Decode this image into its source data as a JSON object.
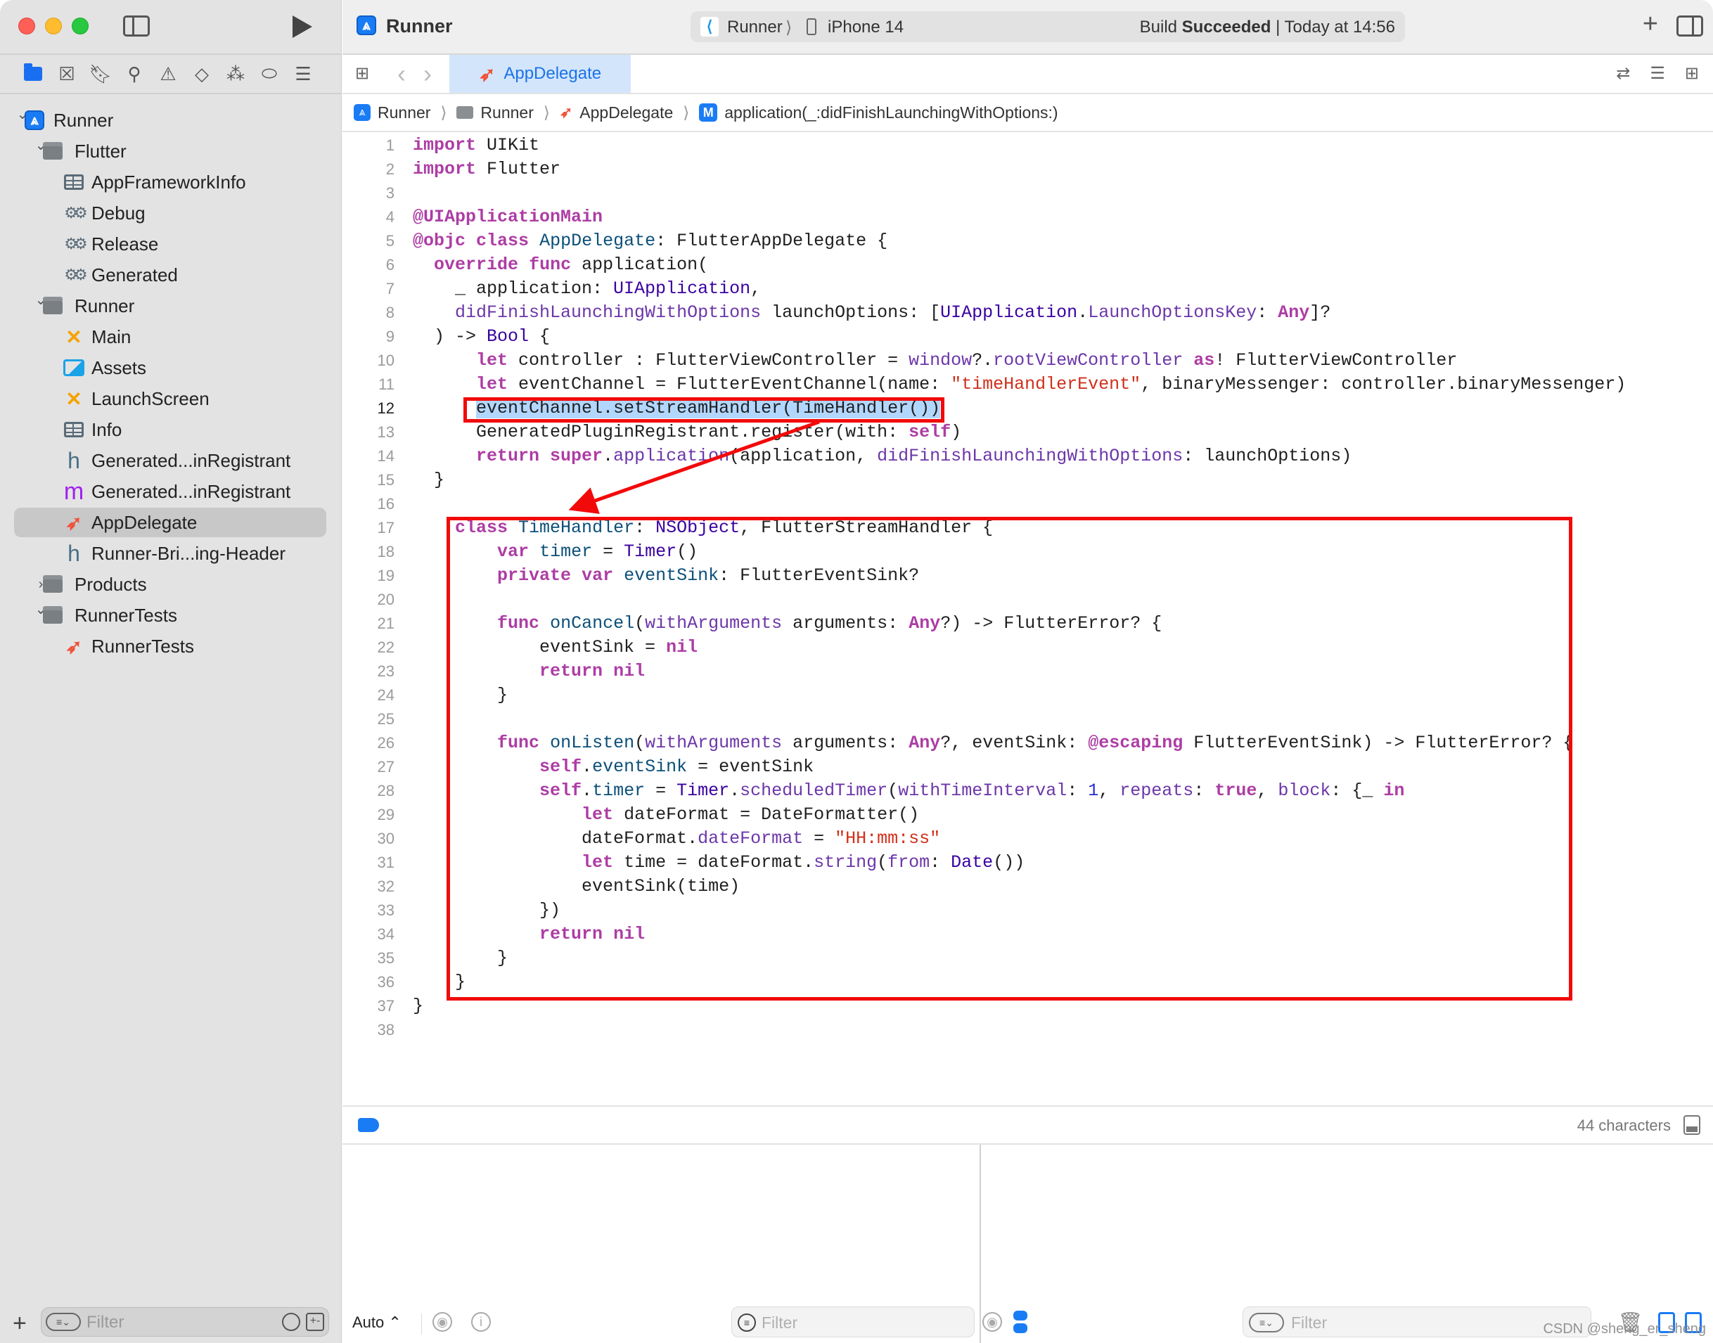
{
  "window": {
    "project_title": "Runner",
    "scheme": "Runner",
    "device": "iPhone 14",
    "build_status_prefix": "Build",
    "build_status": "Succeeded",
    "build_time": "| Today at 14:56"
  },
  "navigator": {
    "icons": [
      "project-navigator-icon",
      "source-control-icon",
      "bookmark-icon",
      "find-icon",
      "issue-icon",
      "test-icon",
      "debug-icon",
      "breakpoint-icon",
      "report-icon"
    ],
    "tree": [
      {
        "label": "Runner",
        "icon": "app-project-icon",
        "level": 0,
        "expanded": true
      },
      {
        "label": "Flutter",
        "icon": "folder-icon",
        "level": 1,
        "expanded": true
      },
      {
        "label": "AppFrameworkInfo",
        "icon": "plist-icon",
        "level": 2
      },
      {
        "label": "Debug",
        "icon": "xcconfig-icon",
        "level": 2
      },
      {
        "label": "Release",
        "icon": "xcconfig-icon",
        "level": 2
      },
      {
        "label": "Generated",
        "icon": "xcconfig-icon",
        "level": 2
      },
      {
        "label": "Runner",
        "icon": "folder-icon",
        "level": 1,
        "expanded": true
      },
      {
        "label": "Main",
        "icon": "storyboard-icon",
        "level": 2
      },
      {
        "label": "Assets",
        "icon": "asset-catalog-icon",
        "level": 2
      },
      {
        "label": "LaunchScreen",
        "icon": "storyboard-icon",
        "level": 2
      },
      {
        "label": "Info",
        "icon": "plist-icon",
        "level": 2
      },
      {
        "label": "Generated...inRegistrant",
        "icon": "header-file-icon",
        "level": 2
      },
      {
        "label": "Generated...inRegistrant",
        "icon": "objc-file-icon",
        "level": 2
      },
      {
        "label": "AppDelegate",
        "icon": "swift-file-icon",
        "level": 2,
        "selected": true
      },
      {
        "label": "Runner-Bri...ing-Header",
        "icon": "header-file-icon",
        "level": 2
      },
      {
        "label": "Products",
        "icon": "folder-icon",
        "level": 1,
        "expanded": false
      },
      {
        "label": "RunnerTests",
        "icon": "folder-icon",
        "level": 1,
        "expanded": true
      },
      {
        "label": "RunnerTests",
        "icon": "swift-file-icon",
        "level": 2
      }
    ],
    "filter_placeholder": "Filter"
  },
  "editor": {
    "active_tab": "AppDelegate",
    "breadcrumb": [
      {
        "label": "Runner",
        "icon": "app-project-icon"
      },
      {
        "label": "Runner",
        "icon": "folder-icon"
      },
      {
        "label": "AppDelegate",
        "icon": "swift-file-icon"
      },
      {
        "label": "application(_:didFinishLaunchingWithOptions:)",
        "icon": "method-icon",
        "badge": "M"
      }
    ],
    "current_line": 12,
    "lines": [
      "import UIKit",
      "import Flutter",
      "",
      "@UIApplicationMain",
      "@objc class AppDelegate: FlutterAppDelegate {",
      "  override func application(",
      "    _ application: UIApplication,",
      "    didFinishLaunchingWithOptions launchOptions: [UIApplication.LaunchOptionsKey: Any]?",
      "  ) -> Bool {",
      "      let controller : FlutterViewController = window?.rootViewController as! FlutterViewController",
      "      let eventChannel = FlutterEventChannel(name: \"timeHandlerEvent\", binaryMessenger: controller.binaryMessenger)",
      "      eventChannel.setStreamHandler(TimeHandler())",
      "      GeneratedPluginRegistrant.register(with: self)",
      "      return super.application(application, didFinishLaunchingWithOptions: launchOptions)",
      "  }",
      "",
      "    class TimeHandler: NSObject, FlutterStreamHandler {",
      "        var timer = Timer()",
      "        private var eventSink: FlutterEventSink?",
      "",
      "        func onCancel(withArguments arguments: Any?) -> FlutterError? {",
      "            eventSink = nil",
      "            return nil",
      "        }",
      "",
      "        func onListen(withArguments arguments: Any?, eventSink: @escaping FlutterEventSink) -> FlutterError? {",
      "            self.eventSink = eventSink",
      "            self.timer = Timer.scheduledTimer(withTimeInterval: 1, repeats: true, block: {_ in",
      "                let dateFormat = DateFormatter()",
      "                dateFormat.dateFormat = \"HH:mm:ss\"",
      "                let time = dateFormat.string(from: Date())",
      "                eventSink(time)",
      "            })",
      "            return nil",
      "        }",
      "    }",
      "}",
      ""
    ],
    "annotations": {
      "highlight_line": 12,
      "boxed_block_lines": [
        17,
        36
      ],
      "color": "#f20a0a"
    }
  },
  "status_bar": {
    "char_count": "44 characters"
  },
  "debug_area": {
    "variables_scope": "Auto ⌃",
    "variables_filter_placeholder": "Filter",
    "console_filter_placeholder": "Filter"
  },
  "watermark": "CSDN @sheng_er_sheng"
}
